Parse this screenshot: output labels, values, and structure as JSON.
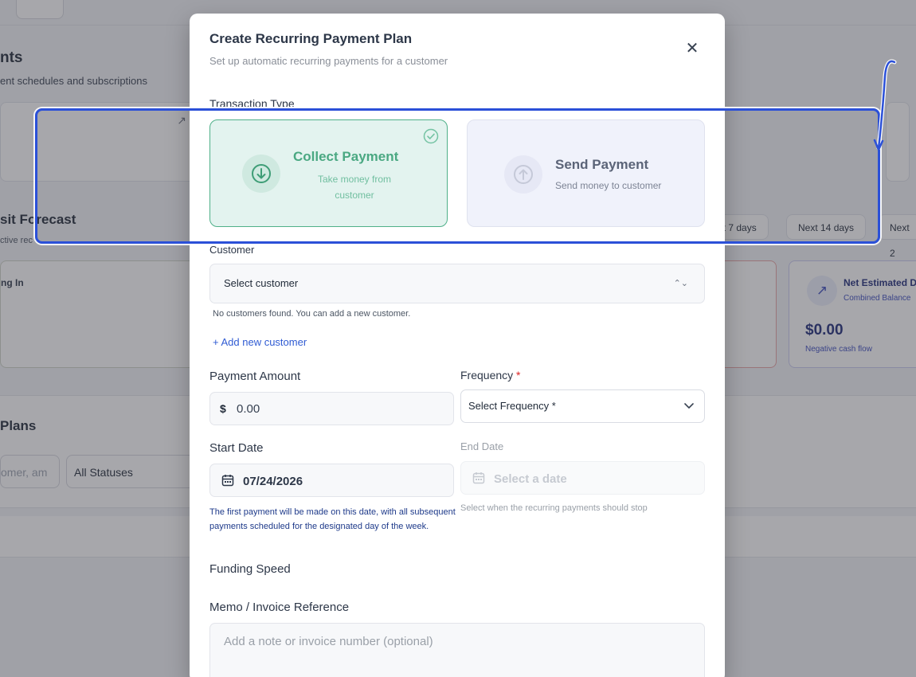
{
  "background": {
    "page_title": "nts",
    "page_subtitle": "ent schedules and subscriptions",
    "forecast_title": "sit Forecast",
    "forecast_sub": "ctive rec",
    "range_pills": [
      "ext 7 days",
      "Next 14 days",
      "Next 2"
    ],
    "incoming_label": "ng In",
    "net_title": "Net Estimated D",
    "net_sub": "Combined Balance",
    "net_value": "$0.00",
    "net_note": "Negative cash flow",
    "plans_title": "Plans",
    "search_placeholder": "omer, am",
    "status_filter": "All Statuses"
  },
  "modal": {
    "title": "Create Recurring Payment Plan",
    "subtitle": "Set up automatic recurring payments for a customer",
    "close_icon": "close-icon",
    "transaction_type_label": "Transaction Type",
    "transaction_types": [
      {
        "title": "Collect Payment",
        "description": "Take money from customer",
        "selected": true,
        "icon": "arrow-down-circle-icon"
      },
      {
        "title": "Send Payment",
        "description": "Send money to customer",
        "selected": false,
        "icon": "arrow-up-circle-icon"
      }
    ],
    "customer_label": "Customer",
    "customer_select": "Select customer",
    "customer_note": "No customers found. You can add a new customer.",
    "add_customer_link": "+ Add new customer",
    "amount_label": "Payment Amount",
    "currency_symbol": "$",
    "amount_value": "0.00",
    "frequency_label": "Frequency",
    "required_mark": "*",
    "frequency_select": "Select Frequency *",
    "start_date_label": "Start Date",
    "start_date_value": "07/24/2026",
    "start_date_help": "The first payment will be made on this date, with all subsequent payments scheduled for the designated day of the week.",
    "end_date_label": "End Date",
    "end_date_placeholder": "Select a date",
    "end_date_help": "Select when the recurring payments should stop",
    "funding_speed_label": "Funding Speed",
    "memo_label": "Memo / Invoice Reference",
    "memo_placeholder": "Add a note or invoice number (optional)"
  },
  "colors": {
    "selected_border": "#4fb089",
    "selected_bg": "#e3f3ef",
    "highlight": "#2b50d8",
    "link": "#2f5bd3"
  }
}
